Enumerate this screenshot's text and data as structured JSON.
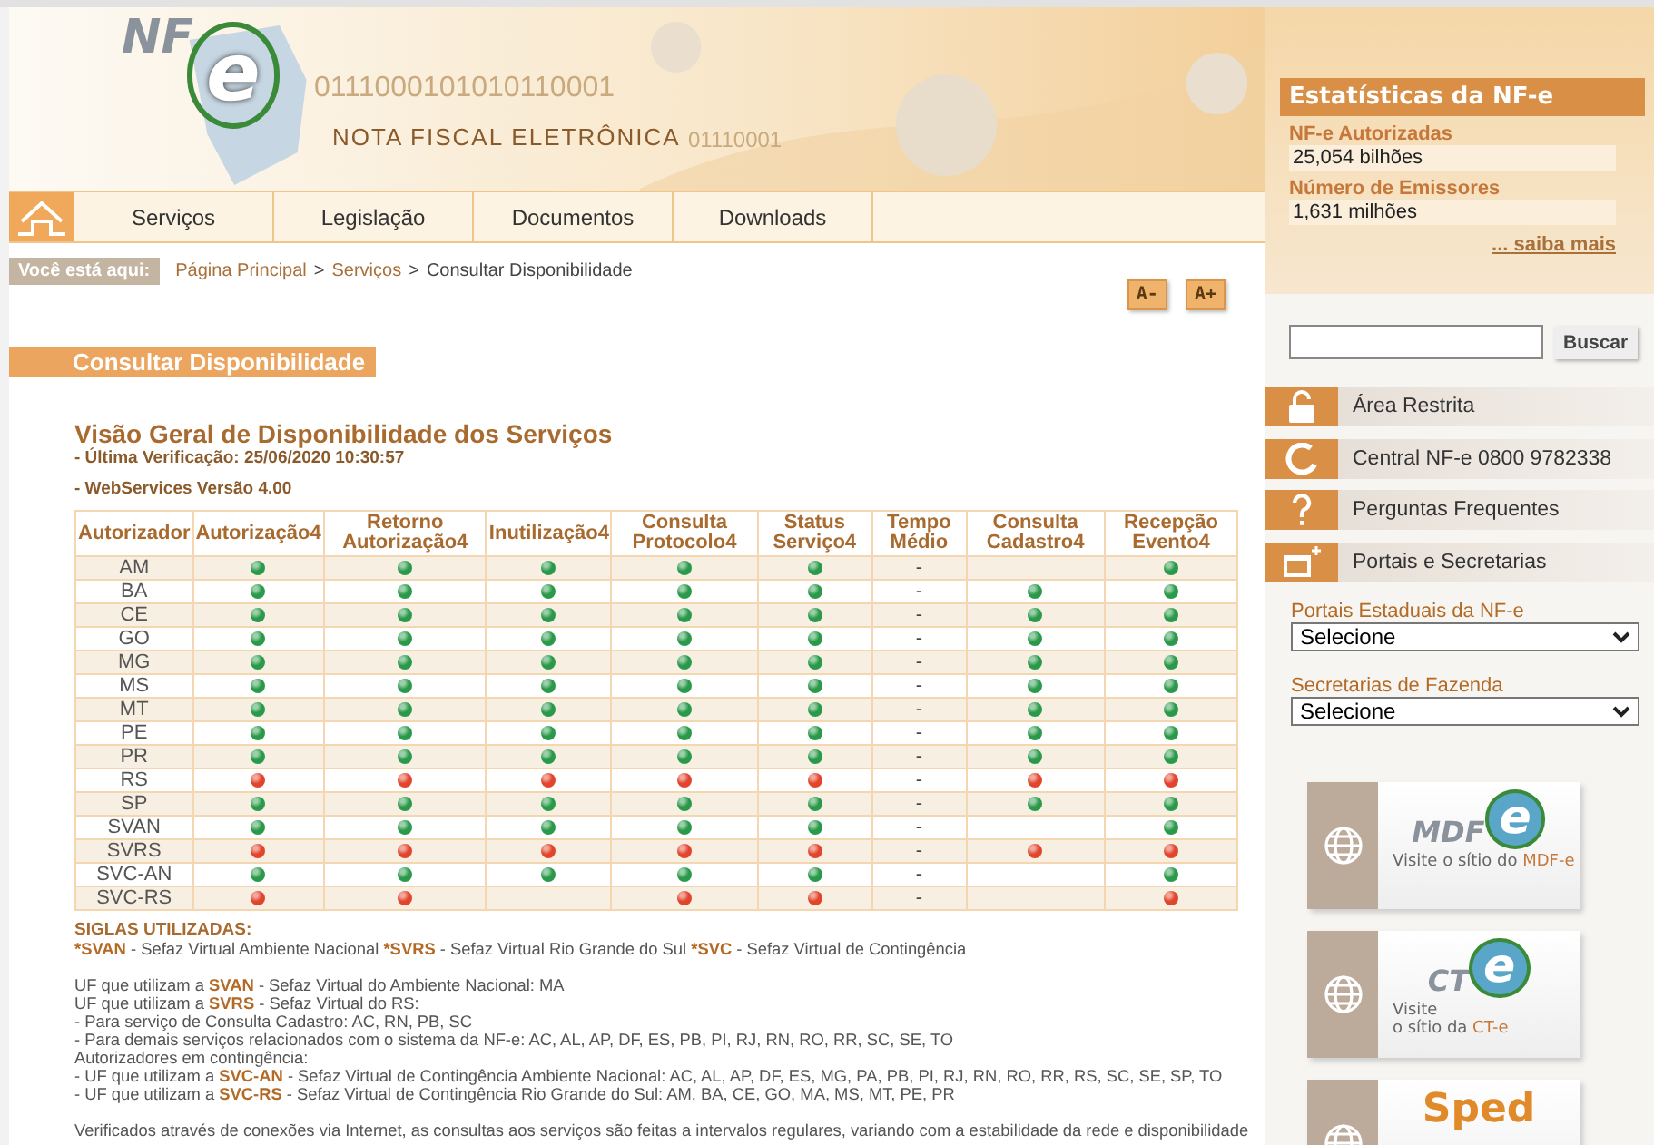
{
  "header": {
    "logo": "NF",
    "logo_letter": "e",
    "title": "NOTA FISCAL ELETRÔNICA",
    "digits": [
      "0111000101010110001",
      "01110001"
    ]
  },
  "nav": {
    "items": [
      {
        "label": "Serviços"
      },
      {
        "label": "Legislação"
      },
      {
        "label": "Documentos"
      },
      {
        "label": "Downloads"
      }
    ]
  },
  "breadcrumb": {
    "label": "Você está aqui:",
    "links": [
      "Página Principal",
      "Serviços"
    ],
    "separators": [
      ">",
      ">"
    ],
    "current": "Consultar Disponibilidade"
  },
  "font_buttons": [
    "A-",
    "A+"
  ],
  "page_title": "Consultar Disponibilidade",
  "heading": "Visão Geral de Disponibilidade dos Serviços",
  "last_check": "- Última Verificação: 25/06/2020 10:30:57",
  "version": "- WebServices Versão 4.00",
  "table": {
    "columns": [
      {
        "label": "Autorizador",
        "kind": "name"
      },
      {
        "label": "Autorização4",
        "kind": "status"
      },
      {
        "label": "Retorno Autorização4",
        "kind": "status"
      },
      {
        "label": "Inutilização4",
        "kind": "status"
      },
      {
        "label": "Consulta Protocolo4",
        "kind": "status"
      },
      {
        "label": "Status Serviço4",
        "kind": "status"
      },
      {
        "label": "Tempo Médio",
        "kind": "tempo"
      },
      {
        "label": "Consulta Cadastro4",
        "kind": "status"
      },
      {
        "label": "Recepção Evento4",
        "kind": "status"
      }
    ],
    "rows": [
      {
        "autorizador": "AM",
        "tempo_medio": "-",
        "cells": [
          {
            "kind": "dot",
            "online": true
          },
          {
            "kind": "dot",
            "online": true
          },
          {
            "kind": "dot",
            "online": true
          },
          {
            "kind": "dot",
            "online": true
          },
          {
            "kind": "dot",
            "online": true
          },
          {
            "kind": "empty"
          },
          {
            "kind": "dot",
            "online": true
          }
        ]
      },
      {
        "autorizador": "BA",
        "tempo_medio": "-",
        "cells": [
          {
            "kind": "dot",
            "online": true
          },
          {
            "kind": "dot",
            "online": true
          },
          {
            "kind": "dot",
            "online": true
          },
          {
            "kind": "dot",
            "online": true
          },
          {
            "kind": "dot",
            "online": true
          },
          {
            "kind": "dot",
            "online": true
          },
          {
            "kind": "dot",
            "online": true
          }
        ]
      },
      {
        "autorizador": "CE",
        "tempo_medio": "-",
        "cells": [
          {
            "kind": "dot",
            "online": true
          },
          {
            "kind": "dot",
            "online": true
          },
          {
            "kind": "dot",
            "online": true
          },
          {
            "kind": "dot",
            "online": true
          },
          {
            "kind": "dot",
            "online": true
          },
          {
            "kind": "dot",
            "online": true
          },
          {
            "kind": "dot",
            "online": true
          }
        ]
      },
      {
        "autorizador": "GO",
        "tempo_medio": "-",
        "cells": [
          {
            "kind": "dot",
            "online": true
          },
          {
            "kind": "dot",
            "online": true
          },
          {
            "kind": "dot",
            "online": true
          },
          {
            "kind": "dot",
            "online": true
          },
          {
            "kind": "dot",
            "online": true
          },
          {
            "kind": "dot",
            "online": true
          },
          {
            "kind": "dot",
            "online": true
          }
        ]
      },
      {
        "autorizador": "MG",
        "tempo_medio": "-",
        "cells": [
          {
            "kind": "dot",
            "online": true
          },
          {
            "kind": "dot",
            "online": true
          },
          {
            "kind": "dot",
            "online": true
          },
          {
            "kind": "dot",
            "online": true
          },
          {
            "kind": "dot",
            "online": true
          },
          {
            "kind": "dot",
            "online": true
          },
          {
            "kind": "dot",
            "online": true
          }
        ]
      },
      {
        "autorizador": "MS",
        "tempo_medio": "-",
        "cells": [
          {
            "kind": "dot",
            "online": true
          },
          {
            "kind": "dot",
            "online": true
          },
          {
            "kind": "dot",
            "online": true
          },
          {
            "kind": "dot",
            "online": true
          },
          {
            "kind": "dot",
            "online": true
          },
          {
            "kind": "dot",
            "online": true
          },
          {
            "kind": "dot",
            "online": true
          }
        ]
      },
      {
        "autorizador": "MT",
        "tempo_medio": "-",
        "cells": [
          {
            "kind": "dot",
            "online": true
          },
          {
            "kind": "dot",
            "online": true
          },
          {
            "kind": "dot",
            "online": true
          },
          {
            "kind": "dot",
            "online": true
          },
          {
            "kind": "dot",
            "online": true
          },
          {
            "kind": "dot",
            "online": true
          },
          {
            "kind": "dot",
            "online": true
          }
        ]
      },
      {
        "autorizador": "PE",
        "tempo_medio": "-",
        "cells": [
          {
            "kind": "dot",
            "online": true
          },
          {
            "kind": "dot",
            "online": true
          },
          {
            "kind": "dot",
            "online": true
          },
          {
            "kind": "dot",
            "online": true
          },
          {
            "kind": "dot",
            "online": true
          },
          {
            "kind": "dot",
            "online": true
          },
          {
            "kind": "dot",
            "online": true
          }
        ]
      },
      {
        "autorizador": "PR",
        "tempo_medio": "-",
        "cells": [
          {
            "kind": "dot",
            "online": true
          },
          {
            "kind": "dot",
            "online": true
          },
          {
            "kind": "dot",
            "online": true
          },
          {
            "kind": "dot",
            "online": true
          },
          {
            "kind": "dot",
            "online": true
          },
          {
            "kind": "dot",
            "online": true
          },
          {
            "kind": "dot",
            "online": true
          }
        ]
      },
      {
        "autorizador": "RS",
        "tempo_medio": "-",
        "cells": [
          {
            "kind": "dot",
            "online": false
          },
          {
            "kind": "dot",
            "online": false
          },
          {
            "kind": "dot",
            "online": false
          },
          {
            "kind": "dot",
            "online": false
          },
          {
            "kind": "dot",
            "online": false
          },
          {
            "kind": "dot",
            "online": false
          },
          {
            "kind": "dot",
            "online": false
          }
        ]
      },
      {
        "autorizador": "SP",
        "tempo_medio": "-",
        "cells": [
          {
            "kind": "dot",
            "online": true
          },
          {
            "kind": "dot",
            "online": true
          },
          {
            "kind": "dot",
            "online": true
          },
          {
            "kind": "dot",
            "online": true
          },
          {
            "kind": "dot",
            "online": true
          },
          {
            "kind": "dot",
            "online": true
          },
          {
            "kind": "dot",
            "online": true
          }
        ]
      },
      {
        "autorizador": "SVAN",
        "tempo_medio": "-",
        "cells": [
          {
            "kind": "dot",
            "online": true
          },
          {
            "kind": "dot",
            "online": true
          },
          {
            "kind": "dot",
            "online": true
          },
          {
            "kind": "dot",
            "online": true
          },
          {
            "kind": "dot",
            "online": true
          },
          {
            "kind": "empty"
          },
          {
            "kind": "dot",
            "online": true
          }
        ]
      },
      {
        "autorizador": "SVRS",
        "tempo_medio": "-",
        "cells": [
          {
            "kind": "dot",
            "online": false
          },
          {
            "kind": "dot",
            "online": false
          },
          {
            "kind": "dot",
            "online": false
          },
          {
            "kind": "dot",
            "online": false
          },
          {
            "kind": "dot",
            "online": false
          },
          {
            "kind": "dot",
            "online": false
          },
          {
            "kind": "dot",
            "online": false
          }
        ]
      },
      {
        "autorizador": "SVC-AN",
        "tempo_medio": "-",
        "cells": [
          {
            "kind": "dot",
            "online": true
          },
          {
            "kind": "dot",
            "online": true
          },
          {
            "kind": "dot",
            "online": true
          },
          {
            "kind": "dot",
            "online": true
          },
          {
            "kind": "dot",
            "online": true
          },
          {
            "kind": "empty"
          },
          {
            "kind": "dot",
            "online": true
          }
        ]
      },
      {
        "autorizador": "SVC-RS",
        "tempo_medio": "-",
        "cells": [
          {
            "kind": "dot",
            "online": false
          },
          {
            "kind": "dot",
            "online": false
          },
          {
            "kind": "empty"
          },
          {
            "kind": "dot",
            "online": false
          },
          {
            "kind": "dot",
            "online": false
          },
          {
            "kind": "empty"
          },
          {
            "kind": "dot",
            "online": false
          }
        ]
      }
    ]
  },
  "notes_title": "SIGLAS UTILIZADAS:",
  "notes": [
    [
      {
        "parts": [
          {
            "text": "*SVAN",
            "bold": true
          },
          {
            "text": " - Sefaz Virtual Ambiente Nacional ",
            "bold": false
          },
          {
            "text": "*SVRS",
            "bold": true
          },
          {
            "text": " - Sefaz Virtual Rio Grande do Sul ",
            "bold": false
          },
          {
            "text": "*SVC",
            "bold": true
          },
          {
            "text": " - Sefaz Virtual de Contingência",
            "bold": false
          }
        ]
      }
    ],
    [
      {
        "parts": [
          {
            "text": "UF que utilizam a ",
            "bold": false
          },
          {
            "text": "SVAN",
            "bold": true
          },
          {
            "text": " - Sefaz Virtual do Ambiente Nacional: MA",
            "bold": false
          }
        ]
      },
      {
        "parts": [
          {
            "text": "UF que utilizam a ",
            "bold": false
          },
          {
            "text": "SVRS",
            "bold": true
          },
          {
            "text": " - Sefaz Virtual do RS:",
            "bold": false
          }
        ]
      },
      {
        "parts": [
          {
            "text": "- Para serviço de Consulta Cadastro: AC, RN, PB, SC",
            "bold": false
          }
        ]
      },
      {
        "parts": [
          {
            "text": "- Para demais serviços relacionados com o sistema da NF-e: AC, AL, AP, DF, ES, PB, PI, RJ, RN, RO, RR, SC, SE, TO",
            "bold": false
          }
        ]
      },
      {
        "parts": [
          {
            "text": "Autorizadores em contingência:",
            "bold": false
          }
        ]
      },
      {
        "parts": [
          {
            "text": "- UF que utilizam a ",
            "bold": false
          },
          {
            "text": "SVC-AN",
            "bold": true
          },
          {
            "text": " - Sefaz Virtual de Contingência Ambiente Nacional: AC, AL, AP, DF, ES, MG, PA, PB, PI, RJ, RN, RO, RR, RS, SC, SE, SP, TO",
            "bold": false
          }
        ]
      },
      {
        "parts": [
          {
            "text": "- UF que utilizam a ",
            "bold": false
          },
          {
            "text": "SVC-RS",
            "bold": true
          },
          {
            "text": " - Sefaz Virtual de Contingência Rio Grande do Sul: AM, BA, CE, GO, MA, MS, MT, PE, PR",
            "bold": false
          }
        ]
      }
    ],
    [
      {
        "parts": [
          {
            "text": "Verificados através de conexões via Internet, as consultas aos serviços são feitas a intervalos regulares, variando com a estabilidade da rede e disponibilidade",
            "bold": false
          }
        ]
      }
    ]
  ],
  "stats": {
    "title": "Estatísticas da NF-e",
    "items": [
      {
        "label": "NF-e Autorizadas",
        "value": "25,054 bilhões"
      },
      {
        "label": "Número de Emissores",
        "value": "1,631 milhões"
      }
    ],
    "more": "... saiba mais"
  },
  "search": {
    "button": "Buscar"
  },
  "menu": [
    {
      "label": "Área Restrita"
    },
    {
      "label": "Central NF-e 0800 9782338"
    },
    {
      "label": "Perguntas Frequentes"
    },
    {
      "label": "Portais e Secretarias"
    }
  ],
  "selects": [
    {
      "label": "Portais Estaduais da NF-e",
      "value": "Selecione"
    },
    {
      "label": "Secretarias de Fazenda",
      "value": "Selecione"
    }
  ],
  "banners": [
    {
      "logo": "MDF",
      "logo_letter": "e",
      "caption": [
        "Visite o sítio do "
      ],
      "highlight": "MDF-e"
    },
    {
      "logo": "CT",
      "logo_letter": "e",
      "caption": [
        "Visite",
        "o sítio da "
      ],
      "highlight": "CT-e"
    },
    {
      "logo": "Sped"
    }
  ]
}
